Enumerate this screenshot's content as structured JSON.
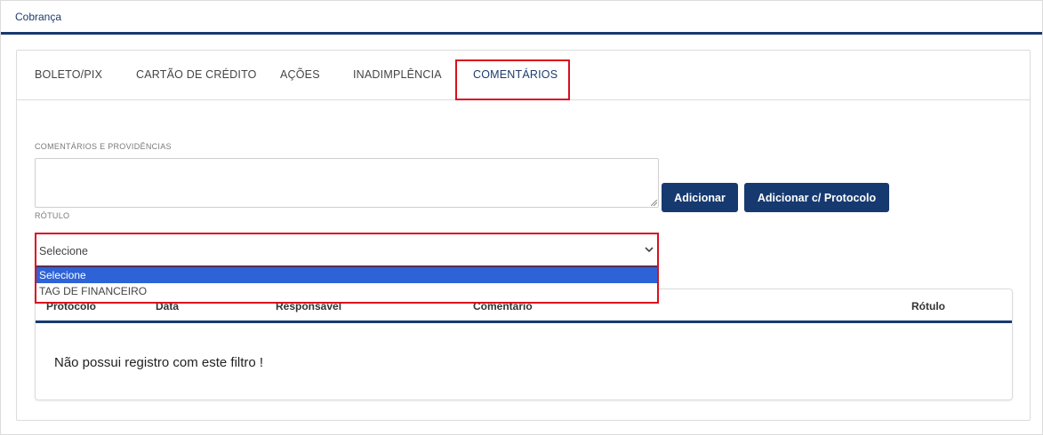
{
  "panel": {
    "title": "Cobrança"
  },
  "tabs": [
    {
      "label": "BOLETO/PIX",
      "active": false
    },
    {
      "label": "CARTÃO DE CRÉDITO",
      "active": false
    },
    {
      "label": "AÇÕES",
      "active": false
    },
    {
      "label": "INADIMPLÊNCIA",
      "active": false
    },
    {
      "label": "COMENTÁRIOS",
      "active": true
    }
  ],
  "form": {
    "comments_label": "COMENTÁRIOS E PROVIDÊNCIAS",
    "comments_value": "",
    "rotulo_label": "RÓTULO",
    "rotulo_selected": "Selecione",
    "rotulo_options": [
      "Selecione",
      "TAG DE FINANCEIRO"
    ],
    "add_button": "Adicionar",
    "add_protocol_button": "Adicionar c/ Protocolo"
  },
  "table": {
    "columns": [
      "Protocolo",
      "Data",
      "Responsável",
      "Comentário",
      "Rótulo"
    ],
    "empty_message": "Não possui registro com este filtro !"
  },
  "colors": {
    "primary": "#163a70",
    "highlight": "#d9101e",
    "option_selected": "#2d63d6"
  },
  "icons": {
    "select_chevron": "chevron-down-icon",
    "textarea_resize": "resize-grip-icon"
  }
}
